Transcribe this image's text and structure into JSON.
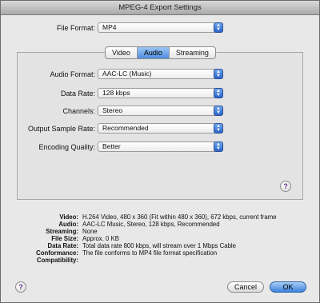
{
  "window": {
    "title": "MPEG-4 Export Settings"
  },
  "file_format": {
    "label": "File Format:",
    "value": "MP4"
  },
  "tabs": [
    {
      "label": "Video",
      "active": false
    },
    {
      "label": "Audio",
      "active": true
    },
    {
      "label": "Streaming",
      "active": false
    }
  ],
  "audio": {
    "format": {
      "label": "Audio Format:",
      "value": "AAC-LC (Music)"
    },
    "data_rate": {
      "label": "Data Rate:",
      "value": "128 kbps"
    },
    "channels": {
      "label": "Channels:",
      "value": "Stereo"
    },
    "sample_rate": {
      "label": "Output Sample Rate:",
      "value": "Recommended"
    },
    "quality": {
      "label": "Encoding Quality:",
      "value": "Better"
    }
  },
  "help_icon": "?",
  "summary": [
    {
      "key": "Video:",
      "value": "H.264 Video, 480 x 360 (Fit within 480 x 360), 672 kbps, current frame"
    },
    {
      "key": "Audio:",
      "value": "AAC-LC Music, Stereo, 128 kbps, Recommended"
    },
    {
      "key": "Streaming:",
      "value": "None"
    },
    {
      "key": "File Size:",
      "value": "Approx. 0 KB"
    },
    {
      "key": "Data Rate:",
      "value": "Total data rate 800 kbps, will stream over 1 Mbps Cable"
    },
    {
      "key": "Conformance:",
      "value": "The file conforms to MP4 file format specification"
    },
    {
      "key": "Compatibility:",
      "value": ""
    }
  ],
  "buttons": {
    "cancel": "Cancel",
    "ok": "OK"
  },
  "colors": {
    "accent": "#3d82dd",
    "help_glyph": "#5a2d8a"
  }
}
